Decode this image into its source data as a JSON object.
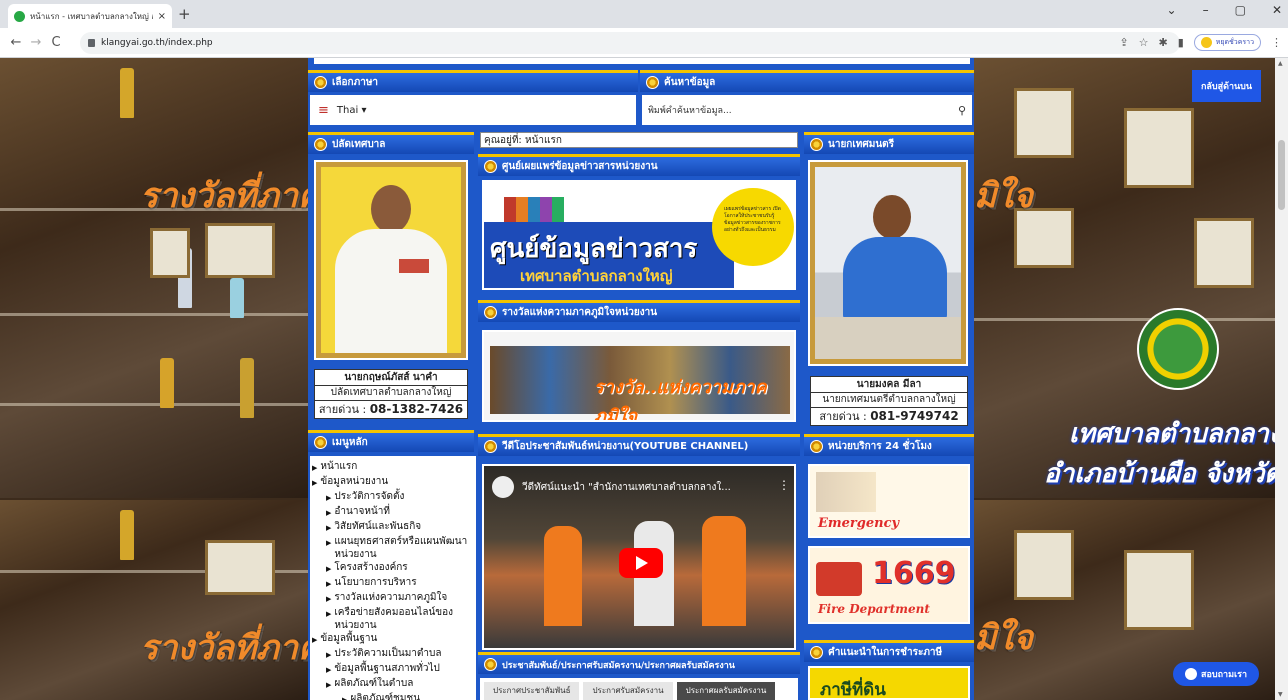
{
  "browser": {
    "tab_title": "หน้าแรก - เทศบาลตำบลกลางใหญ่ อ.บ้านผือ จ.อุดรธานี",
    "tab_close": "×",
    "new_tab": "+",
    "url": "klangyai.go.th/index.php",
    "profile_label": "หยุดชั่วคราว",
    "win_min": "–",
    "win_max": "▢",
    "win_close": "✕",
    "tab_menu": "⌄"
  },
  "page": {
    "back_to_top": "กลับสู่ด้านบน",
    "chat_button": "สอบถามเรา"
  },
  "background": {
    "caption_left": "รางวัลที่ภาคภู",
    "caption_right": "มิใจ",
    "caption_left2": "รางวัลที่ภาคภู",
    "caption_right2": "มิใจ",
    "org_line1": "เทศบาลตำบลกลางใหญ่",
    "org_line2": "อำเภอบ้านผือ จังหวัดอุด"
  },
  "language": {
    "header": "เลือกภาษา",
    "selected": "Thai ▾"
  },
  "search": {
    "header": "ค้นหาข้อมูล",
    "placeholder": "พิมพ์คำค้นหาข้อมูล..."
  },
  "left_official": {
    "header": "ปลัดเทศบาล",
    "name": "นายกฤษณ์ภัสส์ นาคำ",
    "position": "ปลัดเทศบาลตำบลกลางใหญ่",
    "hotline_label": "สายด่วน :",
    "hotline": "08-1382-7426"
  },
  "right_official": {
    "header": "นายกเทศมนตรี",
    "name": "นายมงคล มีลา",
    "position": "นายกเทศมนตรีตำบลกลางใหญ่",
    "hotline_label": "สายด่วน :",
    "hotline": "081-9749742"
  },
  "breadcrumb": "คุณอยู่ที่: หน้าแรก",
  "center": {
    "info_header": "ศูนย์เผยแพร่ข้อมูลข่าวสารหน่วยงาน",
    "info_banner_title": "ศูนย์ข้อมูลข่าวสาร",
    "info_banner_sub": "เทศบาลตำบลกลางใหญ่",
    "info_quote": "เผยแพร่ข้อมูลข่าวสาร เปิดโอกาสให้ประชาชนรับรู้ ข้อมูลข่าวสารของราชการ อย่างทั่วถึงและเป็นธรรม",
    "award_header": "รางวัลแห่งความภาคภูมิใจหน่วยงาน",
    "award_text": "รางวัล..แห่งความภาคภูมิใจ",
    "video_header": "วีดีโอประชาสัมพันธ์หน่วยงาน(YOUTUBE CHANNEL)",
    "video_title": "วีดีทัศน์แนะนำ \"สำนักงานเทศบาลตำบลกลางใ...",
    "video_more": "⋮",
    "pr_header": "ประชาสัมพันธ์/ประกาศรับสมัครงาน/ประกาศผลรับสมัครงาน",
    "tabs": [
      "ประกาศประชาสัมพันธ์",
      "ประกาศรับสมัครงาน",
      "ประกาศผลรับสมัครงาน"
    ]
  },
  "main_menu": {
    "header": "เมนูหลัก",
    "items": [
      {
        "label": "หน้าแรก",
        "level": 0
      },
      {
        "label": "ข้อมูลหน่วยงาน",
        "level": 0
      },
      {
        "label": "ประวัติการจัดตั้ง",
        "level": 1
      },
      {
        "label": "อำนาจหน้าที่",
        "level": 1
      },
      {
        "label": "วิสัยทัศน์และพันธกิจ",
        "level": 1
      },
      {
        "label": "แผนยุทธศาสตร์หรือแผนพัฒนาหน่วยงาน",
        "level": 1
      },
      {
        "label": "โครงสร้างองค์กร",
        "level": 1
      },
      {
        "label": "นโยบายการบริหาร",
        "level": 1
      },
      {
        "label": "รางวัลแห่งความภาคภูมิใจ",
        "level": 1
      },
      {
        "label": "เครือข่ายสังคมออนไลน์ของหน่วยงาน",
        "level": 1
      },
      {
        "label": "ข้อมูลพื้นฐาน",
        "level": 0
      },
      {
        "label": "ประวัติความเป็นมาตำบล",
        "level": 1
      },
      {
        "label": "ข้อมูลพื้นฐานสภาพทั่วไป",
        "level": 1
      },
      {
        "label": "ผลิตภัณฑ์ในตำบล",
        "level": 1
      },
      {
        "label": "ผลิตภัณฑ์ชุมชน",
        "level": 2
      }
    ]
  },
  "services": {
    "header": "หน่วยบริการ 24 ชั่วโมง",
    "emergency": "Emergency",
    "fire_number": "1669",
    "fire_label": "Fire Department",
    "tax_header": "คำแนะนำในการชำระภาษี",
    "tax_banner": "ภาษีที่ดิน"
  },
  "colors": {
    "site_blue": "#1e58c9",
    "header_gold": "#f5c400",
    "accent_orange": "#f08a2a"
  }
}
